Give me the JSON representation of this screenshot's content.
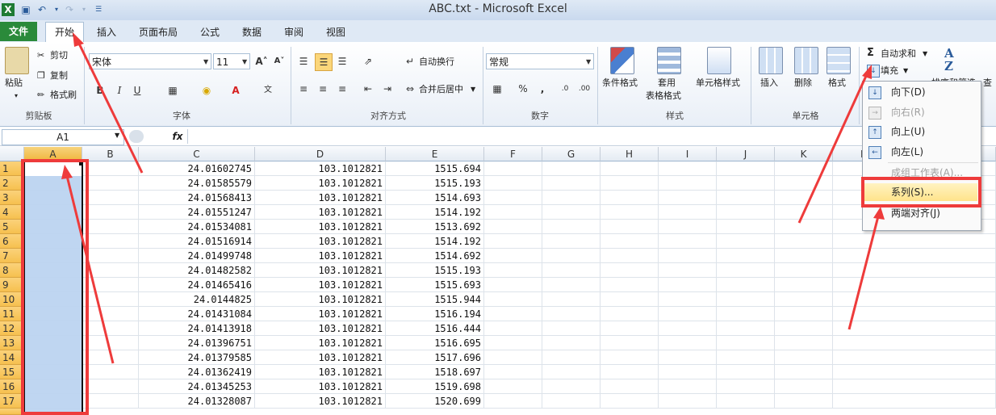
{
  "window": {
    "title": "ABC.txt - Microsoft Excel"
  },
  "tabs": [
    {
      "label": "文件"
    },
    {
      "label": "开始"
    },
    {
      "label": "插入"
    },
    {
      "label": "页面布局"
    },
    {
      "label": "公式"
    },
    {
      "label": "数据"
    },
    {
      "label": "审阅"
    },
    {
      "label": "视图"
    }
  ],
  "clipboard": {
    "paste": "粘贴",
    "cut": "剪切",
    "copy": "复制",
    "format_painter": "格式刷",
    "group": "剪贴板"
  },
  "font": {
    "name": "宋体",
    "size": "11",
    "group": "字体",
    "bold": "B",
    "italic": "I",
    "underline": "U"
  },
  "alignment": {
    "wrap": "自动换行",
    "merge": "合并后居中",
    "group": "对齐方式"
  },
  "number": {
    "format": "常规",
    "percent": "%",
    "comma": ",",
    "group": "数字"
  },
  "styles": {
    "conditional": "条件格式",
    "table_line1": "套用",
    "table_line2": "表格格式",
    "cell_styles": "单元格样式",
    "group": "样式"
  },
  "cells": {
    "insert": "插入",
    "delete": "删除",
    "format": "格式",
    "group": "单元格"
  },
  "editing": {
    "autosum": "自动求和",
    "fill": "填充",
    "sort": "排序和筛选",
    "find": "查"
  },
  "formula_bar": {
    "name_box": "A1",
    "fx": "fx"
  },
  "columns": [
    "A",
    "B",
    "C",
    "D",
    "E",
    "F",
    "G",
    "H",
    "I",
    "J",
    "K",
    "L"
  ],
  "rows": [
    {
      "n": "1",
      "c": "24.01602745",
      "d": "103.1012821",
      "e": "1515.694"
    },
    {
      "n": "2",
      "c": "24.01585579",
      "d": "103.1012821",
      "e": "1515.193"
    },
    {
      "n": "3",
      "c": "24.01568413",
      "d": "103.1012821",
      "e": "1514.693"
    },
    {
      "n": "4",
      "c": "24.01551247",
      "d": "103.1012821",
      "e": "1514.192"
    },
    {
      "n": "5",
      "c": "24.01534081",
      "d": "103.1012821",
      "e": "1513.692"
    },
    {
      "n": "6",
      "c": "24.01516914",
      "d": "103.1012821",
      "e": "1514.192"
    },
    {
      "n": "7",
      "c": "24.01499748",
      "d": "103.1012821",
      "e": "1514.692"
    },
    {
      "n": "8",
      "c": "24.01482582",
      "d": "103.1012821",
      "e": "1515.193"
    },
    {
      "n": "9",
      "c": "24.01465416",
      "d": "103.1012821",
      "e": "1515.693"
    },
    {
      "n": "10",
      "c": "24.0144825",
      "d": "103.1012821",
      "e": "1515.944"
    },
    {
      "n": "11",
      "c": "24.01431084",
      "d": "103.1012821",
      "e": "1516.194"
    },
    {
      "n": "12",
      "c": "24.01413918",
      "d": "103.1012821",
      "e": "1516.444"
    },
    {
      "n": "13",
      "c": "24.01396751",
      "d": "103.1012821",
      "e": "1516.695"
    },
    {
      "n": "14",
      "c": "24.01379585",
      "d": "103.1012821",
      "e": "1517.696"
    },
    {
      "n": "15",
      "c": "24.01362419",
      "d": "103.1012821",
      "e": "1518.697"
    },
    {
      "n": "16",
      "c": "24.01345253",
      "d": "103.1012821",
      "e": "1519.698"
    },
    {
      "n": "17",
      "c": "24.01328087",
      "d": "103.1012821",
      "e": "1520.699"
    }
  ],
  "fill_menu": {
    "items": [
      {
        "label": "向下(D)",
        "enabled": true
      },
      {
        "label": "向右(R)",
        "enabled": false
      },
      {
        "label": "向上(U)",
        "enabled": true
      },
      {
        "label": "向左(L)",
        "enabled": true
      },
      {
        "label": "成组工作表(A)...",
        "enabled": false
      },
      {
        "label": "系列(S)...",
        "enabled": true
      },
      {
        "label": "两端对齐(J)",
        "enabled": true
      }
    ]
  },
  "annotation_color": "#ee3b3b",
  "accent_color": "#2a8a3a"
}
